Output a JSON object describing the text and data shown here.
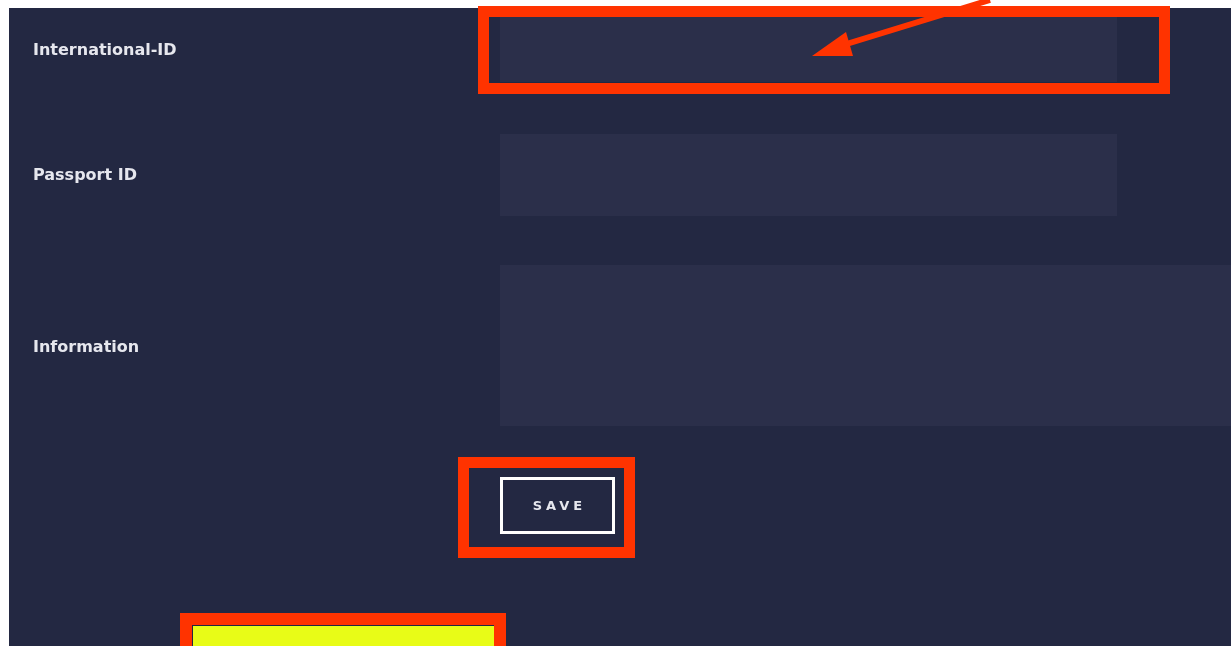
{
  "form": {
    "fields": [
      {
        "label": "International-ID",
        "kind": "text"
      },
      {
        "label": "Passport ID",
        "kind": "text"
      },
      {
        "label": "Information",
        "kind": "textarea"
      }
    ],
    "save_button": {
      "label": "SAVE"
    }
  }
}
